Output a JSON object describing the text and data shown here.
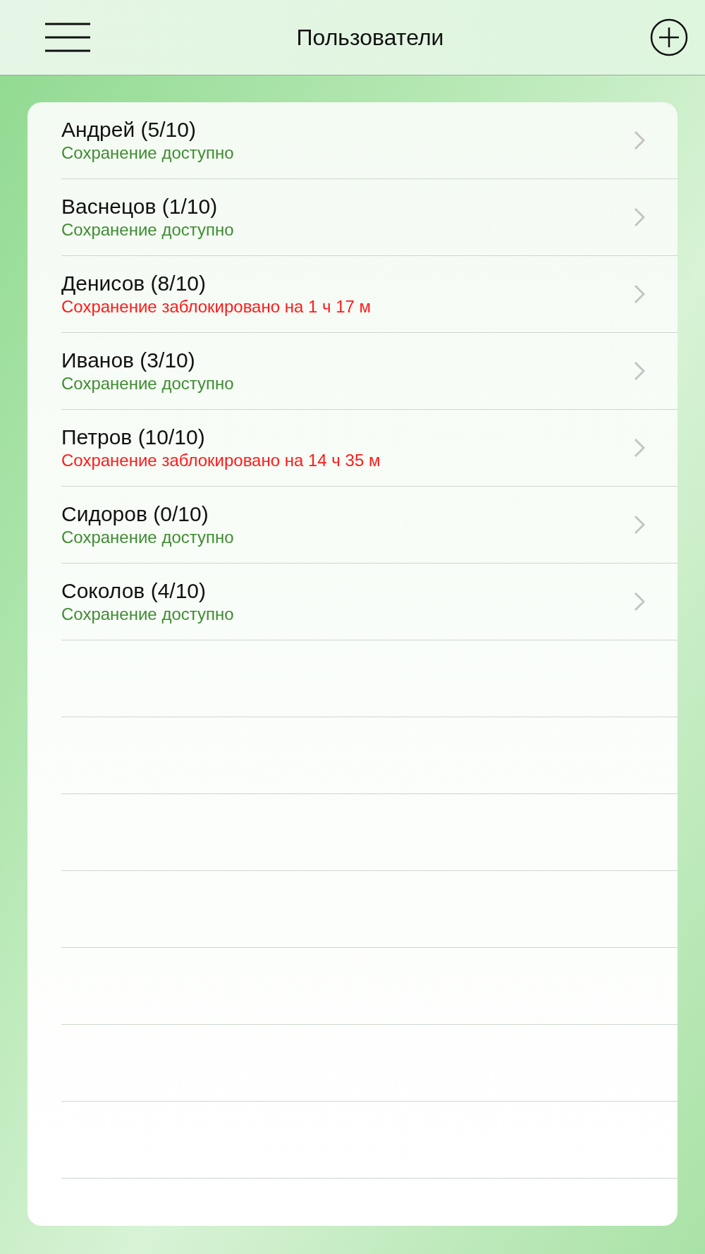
{
  "header": {
    "title": "Пользователи"
  },
  "users": [
    {
      "name": "Андрей (5/10)",
      "status": "Сохранение доступно",
      "kind": "available"
    },
    {
      "name": "Васнецов (1/10)",
      "status": "Сохранение доступно",
      "kind": "available"
    },
    {
      "name": "Денисов (8/10)",
      "status": "Сохранение заблокировано на 1 ч 17 м",
      "kind": "blocked"
    },
    {
      "name": "Иванов (3/10)",
      "status": "Сохранение доступно",
      "kind": "available"
    },
    {
      "name": "Петров (10/10)",
      "status": "Сохранение заблокировано на 14 ч 35 м",
      "kind": "blocked"
    },
    {
      "name": "Сидоров (0/10)",
      "status": "Сохранение доступно",
      "kind": "available"
    },
    {
      "name": "Соколов (4/10)",
      "status": "Сохранение доступно",
      "kind": "available"
    }
  ]
}
